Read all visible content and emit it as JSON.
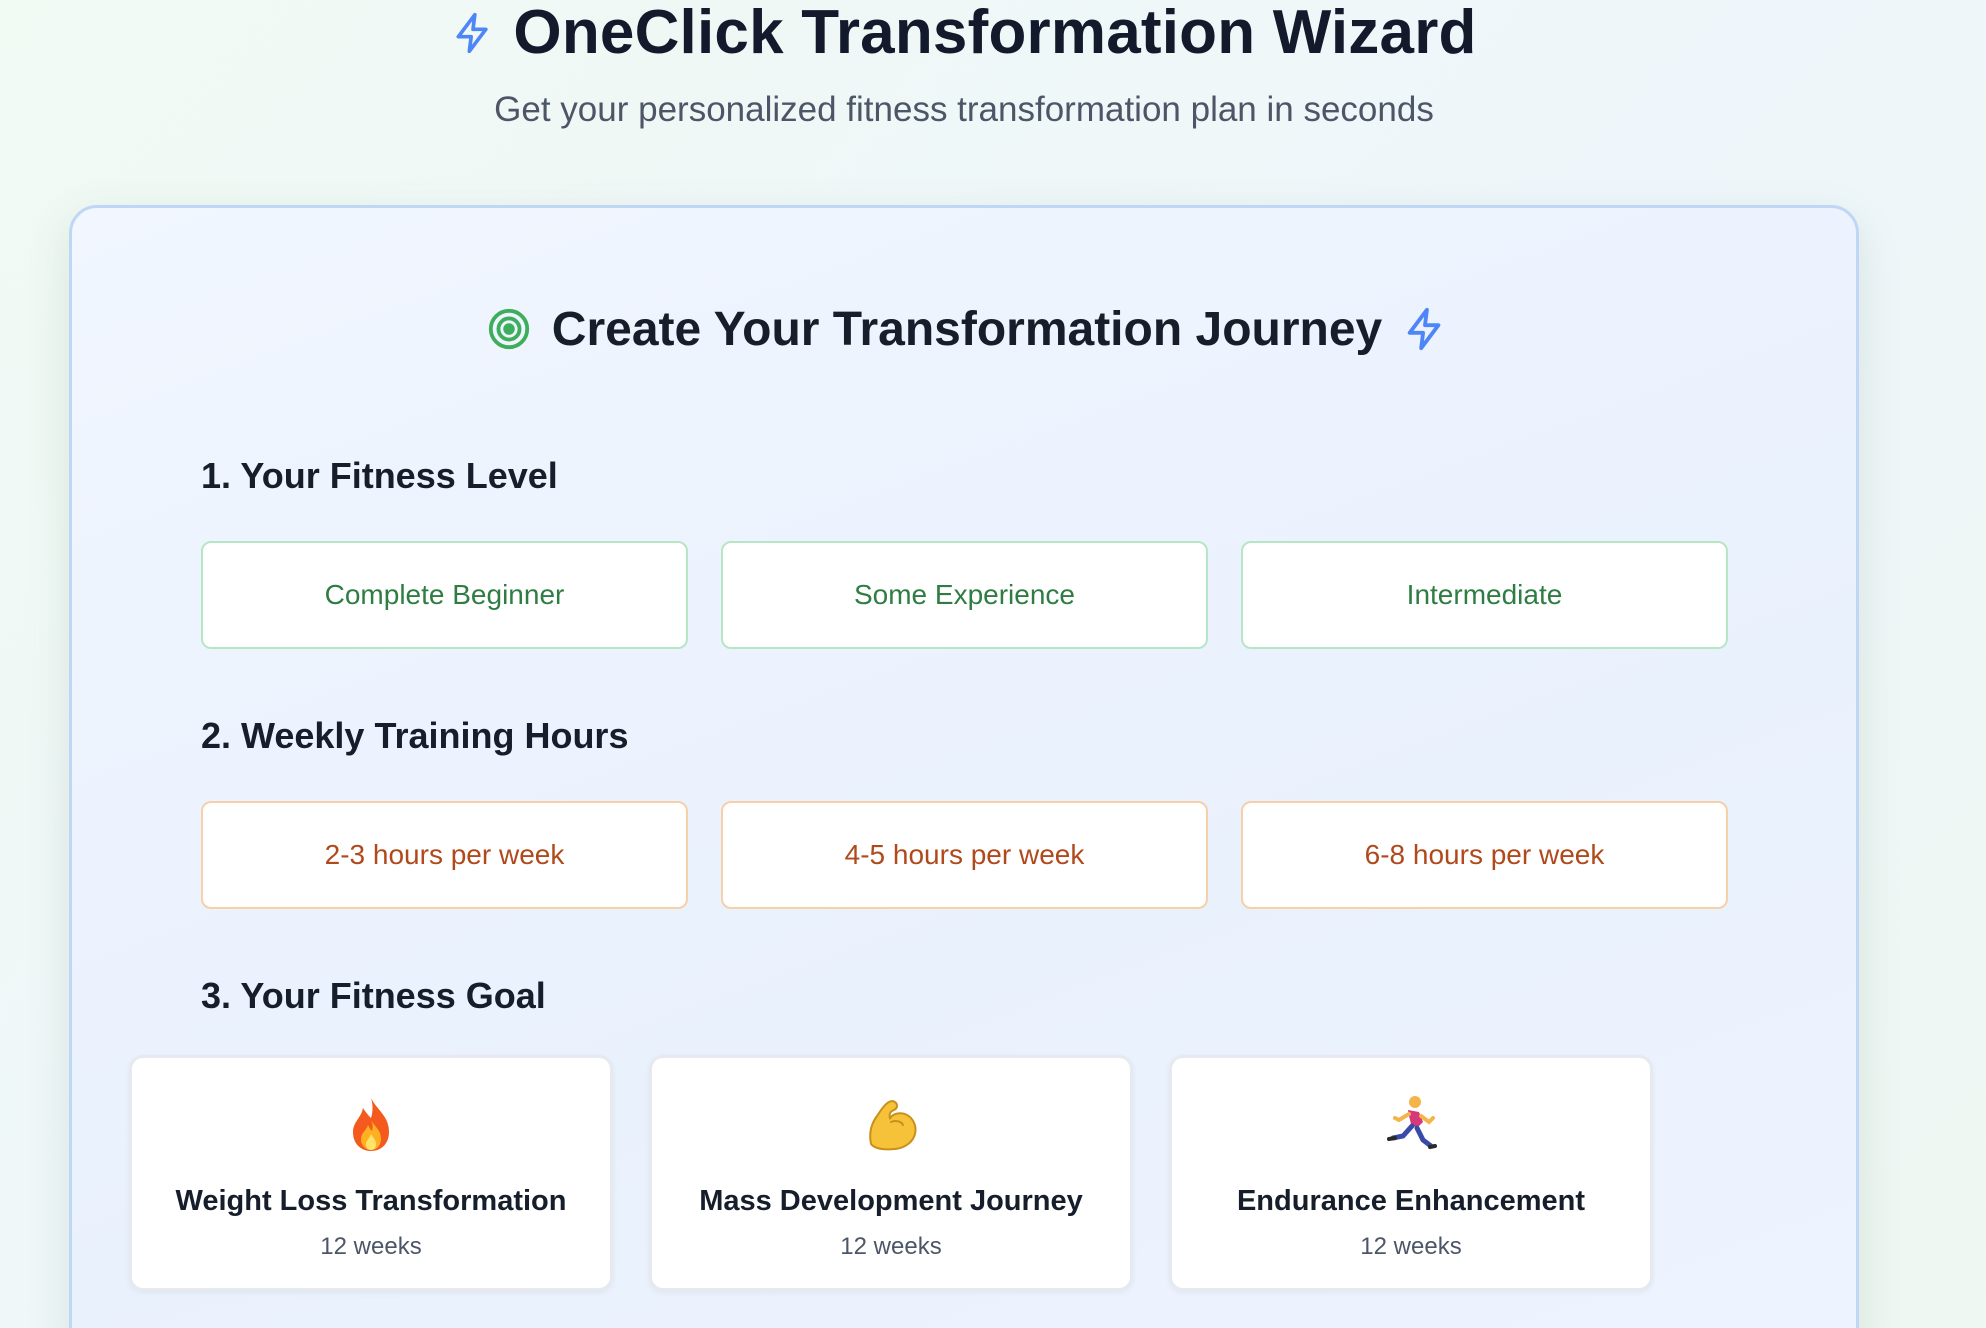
{
  "header": {
    "title": "OneClick Transformation Wizard",
    "subtitle": "Get your personalized fitness transformation plan in seconds",
    "title_icon": "bolt-icon"
  },
  "card": {
    "title": "Create Your Transformation Journey",
    "left_icon": "target-icon",
    "right_icon": "bolt-icon"
  },
  "sections": {
    "fitness_level": {
      "heading": "1. Your Fitness Level",
      "options": [
        "Complete Beginner",
        "Some Experience",
        "Intermediate"
      ]
    },
    "training_hours": {
      "heading": "2. Weekly Training Hours",
      "options": [
        "2-3 hours per week",
        "4-5 hours per week",
        "6-8 hours per week"
      ]
    },
    "fitness_goal": {
      "heading": "3. Your Fitness Goal",
      "goals": [
        {
          "icon": "fire-icon",
          "title": "Weight Loss Transformation",
          "duration": "12 weeks"
        },
        {
          "icon": "flexed-bicep-icon",
          "title": "Mass Development Journey",
          "duration": "12 weeks"
        },
        {
          "icon": "runner-icon",
          "title": "Endurance Enhancement",
          "duration": "12 weeks"
        }
      ]
    }
  },
  "colors": {
    "bolt": "#4f86f7",
    "target": "#3fae5c",
    "level_text": "#2f7d43",
    "level_border": "#b7e6c5",
    "hours_text": "#b04a1c",
    "hours_border": "#f6d0a6"
  }
}
